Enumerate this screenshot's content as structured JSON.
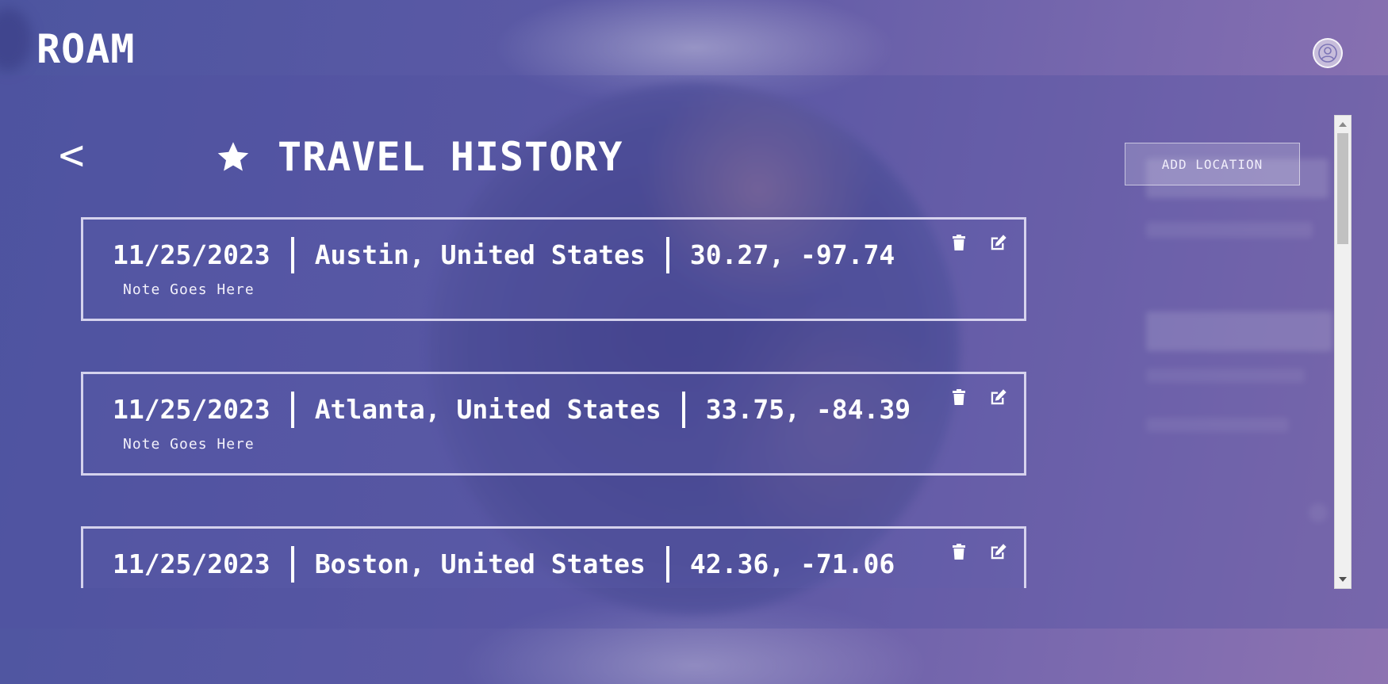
{
  "header": {
    "logo": "ROAM",
    "avatar_icon": "user-circle-icon"
  },
  "page": {
    "back_label": "<",
    "title_icon": "star-icon",
    "title": "TRAVEL HISTORY",
    "add_location_label": "ADD LOCATION"
  },
  "entries": [
    {
      "date": "11/25/2023",
      "place": "Austin, United States",
      "coords": "30.27, -97.74",
      "note": "Note Goes Here"
    },
    {
      "date": "11/25/2023",
      "place": "Atlanta, United States",
      "coords": "33.75, -84.39",
      "note": "Note Goes Here"
    },
    {
      "date": "11/25/2023",
      "place": "Boston, United States",
      "coords": "42.36, -71.06",
      "note": ""
    }
  ],
  "icons": {
    "delete": "trash-icon",
    "edit": "edit-icon"
  },
  "colors": {
    "background_start": "#4d55a0",
    "background_end": "#8d73b1",
    "text": "#ffffff"
  }
}
